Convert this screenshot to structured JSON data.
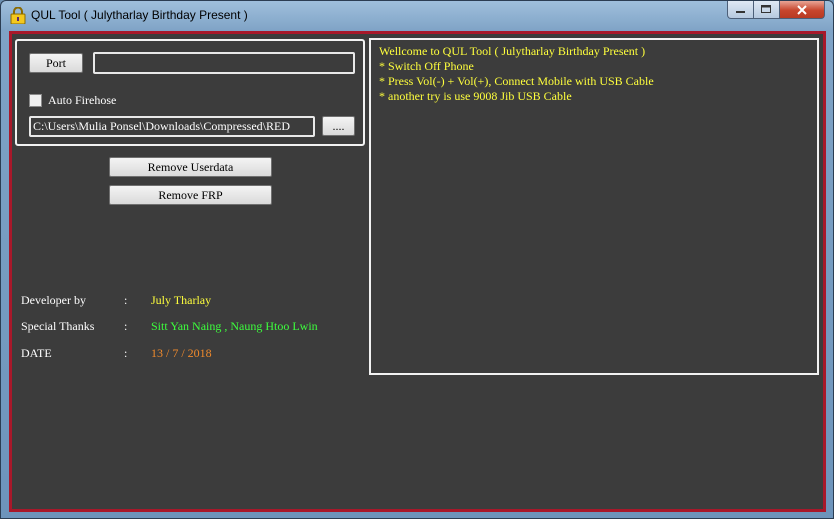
{
  "window": {
    "title": "QUL Tool ( Julytharlay Birthday Present )",
    "icon": "lock-icon",
    "frame_color": "#a8182a",
    "background": "#3c3c3c"
  },
  "left_panel": {
    "port_button": "Port",
    "port_value": "",
    "auto_firehose": {
      "label": "Auto Firehose",
      "checked": false
    },
    "path_value": "C:\\Users\\Mulia Ponsel\\Downloads\\Compressed\\RED",
    "browse_button": "...."
  },
  "actions": {
    "remove_userdata": "Remove Userdata",
    "remove_frp": "Remove FRP"
  },
  "info": [
    {
      "label": "Developer by",
      "sep": ":",
      "value": "July Tharlay",
      "color": "#ffff3c"
    },
    {
      "label": "Special Thanks",
      "sep": ":",
      "value": "Sitt Yan Naing , Naung Htoo Lwin",
      "color": "#3cff3c"
    },
    {
      "label": "DATE",
      "sep": ":",
      "value": "13 / 7 / 2018",
      "color": "#f08a2c"
    }
  ],
  "log": {
    "lines": [
      "Wellcome to QUL Tool ( Julytharlay Birthday Present )",
      "* Switch Off Phone",
      "* Press Vol(-) + Vol(+), Connect Mobile with USB Cable",
      "* another try is use 9008 Jib USB Cable"
    ],
    "color": "#ffff3c"
  }
}
